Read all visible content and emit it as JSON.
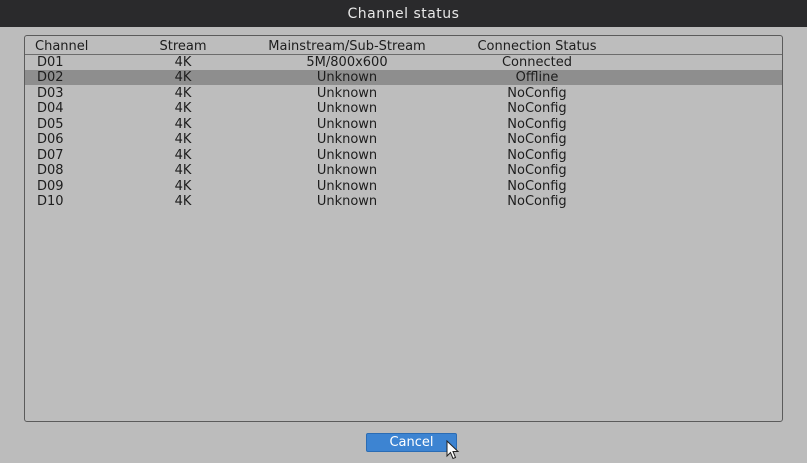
{
  "window": {
    "title": "Channel status"
  },
  "table": {
    "headers": {
      "channel": "Channel",
      "stream": "Stream",
      "mainstream": "Mainstream/Sub-Stream",
      "connection": "Connection Status"
    },
    "rows": [
      {
        "channel": "D01",
        "stream": "4K",
        "mainstream": "5M/800x600",
        "connection": "Connected"
      },
      {
        "channel": "D02",
        "stream": "4K",
        "mainstream": "Unknown",
        "connection": "Offline"
      },
      {
        "channel": "D03",
        "stream": "4K",
        "mainstream": "Unknown",
        "connection": "NoConfig"
      },
      {
        "channel": "D04",
        "stream": "4K",
        "mainstream": "Unknown",
        "connection": "NoConfig"
      },
      {
        "channel": "D05",
        "stream": "4K",
        "mainstream": "Unknown",
        "connection": "NoConfig"
      },
      {
        "channel": "D06",
        "stream": "4K",
        "mainstream": "Unknown",
        "connection": "NoConfig"
      },
      {
        "channel": "D07",
        "stream": "4K",
        "mainstream": "Unknown",
        "connection": "NoConfig"
      },
      {
        "channel": "D08",
        "stream": "4K",
        "mainstream": "Unknown",
        "connection": "NoConfig"
      },
      {
        "channel": "D09",
        "stream": "4K",
        "mainstream": "Unknown",
        "connection": "NoConfig"
      },
      {
        "channel": "D10",
        "stream": "4K",
        "mainstream": "Unknown",
        "connection": "NoConfig"
      }
    ]
  },
  "buttons": {
    "cancel_label": "Cancel"
  },
  "colors": {
    "titlebar": "#2a2a2c",
    "background": "#bdbdbd",
    "selected_row": "#8e8e8e",
    "button": "#3d84d2"
  },
  "icons": {
    "cursor": "mouse-pointer-icon"
  }
}
